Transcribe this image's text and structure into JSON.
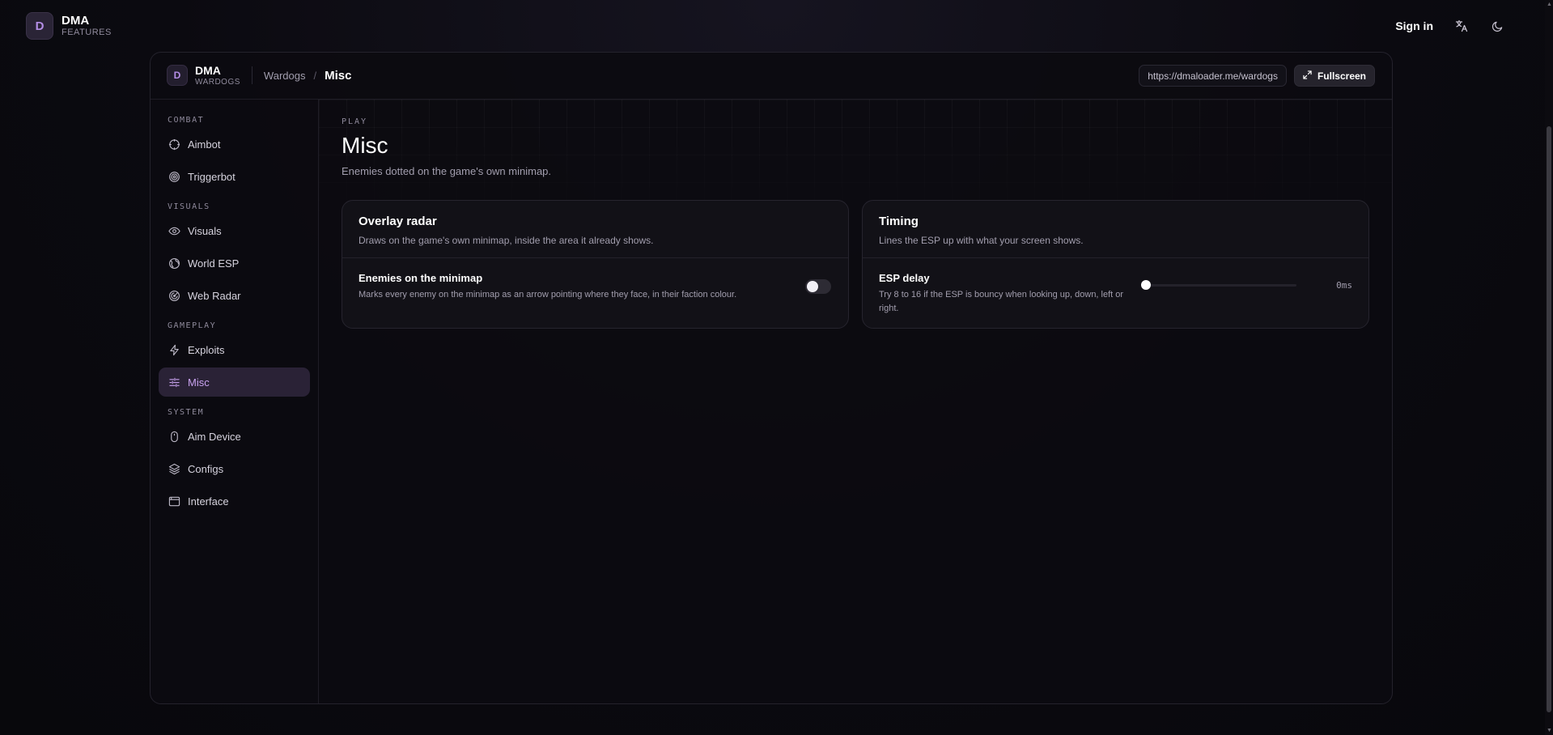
{
  "site": {
    "logo_letter": "D",
    "name": "DMA",
    "subtitle": "FEATURES",
    "signin_label": "Sign in",
    "icons": {
      "translate": "translate-icon",
      "theme": "moon-icon"
    }
  },
  "panel": {
    "logo_letter": "D",
    "brand_name": "DMA",
    "brand_sub": "WARDOGS",
    "breadcrumb": {
      "parent": "Wardogs",
      "separator": "/",
      "current": "Misc"
    },
    "url": "https://dmaloader.me/wardogs",
    "fullscreen_label": "Fullscreen"
  },
  "sidebar": {
    "sections": [
      {
        "label": "COMBAT",
        "items": [
          {
            "label": "Aimbot",
            "icon": "crosshair-icon"
          },
          {
            "label": "Triggerbot",
            "icon": "target-icon"
          }
        ]
      },
      {
        "label": "VISUALS",
        "items": [
          {
            "label": "Visuals",
            "icon": "eye-icon"
          },
          {
            "label": "World ESP",
            "icon": "globe-icon"
          },
          {
            "label": "Web Radar",
            "icon": "radar-icon"
          }
        ]
      },
      {
        "label": "GAMEPLAY",
        "items": [
          {
            "label": "Exploits",
            "icon": "lightning-icon"
          },
          {
            "label": "Misc",
            "icon": "sliders-icon",
            "active": true
          }
        ]
      },
      {
        "label": "SYSTEM",
        "items": [
          {
            "label": "Aim Device",
            "icon": "mouse-icon"
          },
          {
            "label": "Configs",
            "icon": "layers-icon"
          },
          {
            "label": "Interface",
            "icon": "window-icon"
          }
        ]
      }
    ]
  },
  "main": {
    "eyebrow": "PLAY",
    "title": "Misc",
    "subtitle": "Enemies dotted on the game's own minimap.",
    "cards": [
      {
        "title": "Overlay radar",
        "description": "Draws on the game's own minimap, inside the area it already shows.",
        "setting": {
          "title": "Enemies on the minimap",
          "description": "Marks every enemy on the minimap as an arrow pointing where they face, in their faction colour.",
          "enabled": false
        }
      },
      {
        "title": "Timing",
        "description": "Lines the ESP up with what your screen shows.",
        "setting": {
          "title": "ESP delay",
          "description": "Try 8 to 16 if the ESP is bouncy when looking up, down, left or right.",
          "value": 0,
          "value_label": "0ms",
          "level": 0.0
        }
      }
    ]
  },
  "colors": {
    "accent": "#c9a2f0",
    "active_bg": "#2a2236",
    "background": "#0b0a10"
  }
}
